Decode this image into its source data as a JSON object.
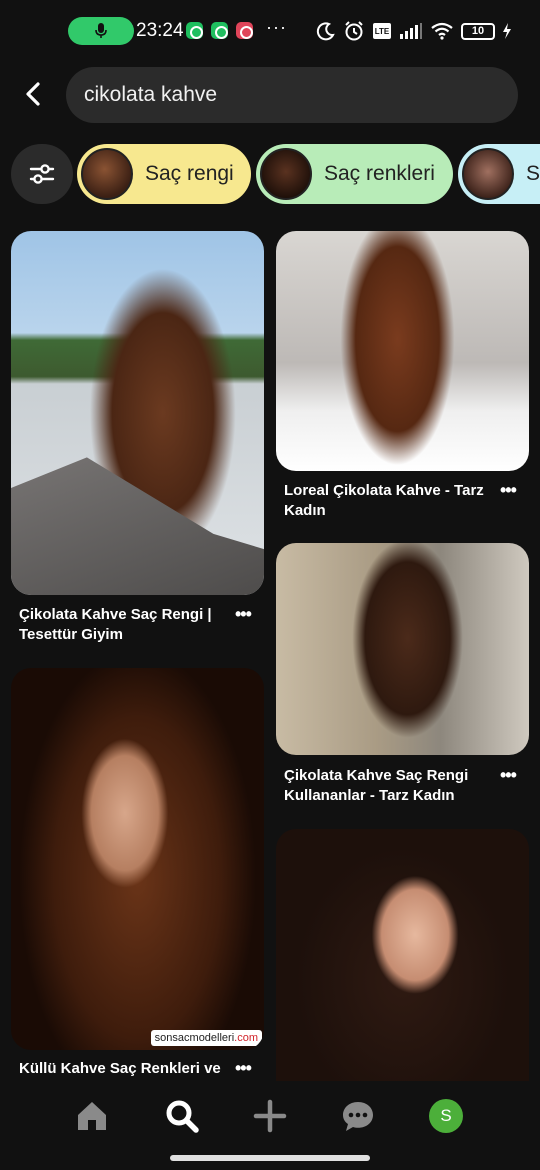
{
  "status_bar": {
    "time": "23:24",
    "more": "···",
    "battery": "10"
  },
  "search": {
    "query": "cikolata kahve"
  },
  "chips": [
    {
      "label": "Saç rengi",
      "color": "#f7e88f"
    },
    {
      "label": "Saç renkleri",
      "color": "#b8ecb8"
    },
    {
      "label": "Sa",
      "color": "#c7eff6"
    }
  ],
  "pins": [
    {
      "title": "Çikolata Kahve Saç Rengi | Tesettür Giyim"
    },
    {
      "title": "Loreal Çikolata Kahve - Tarz Kadın"
    },
    {
      "title": "Çikolata Kahve Saç Rengi Kullananlar - Tarz Kadın"
    },
    {
      "title": "Küllü Kahve Saç Renkleri ve",
      "watermark_prefix": "sonsacmodelleri",
      "watermark_suffix": ".com"
    },
    {
      "title": ""
    }
  ],
  "more_label": "•••",
  "nav": {
    "avatar_letter": "S"
  },
  "colors": {
    "background": "#111111",
    "search_bg": "#2b2b2b",
    "avatar": "#4caf3a"
  }
}
